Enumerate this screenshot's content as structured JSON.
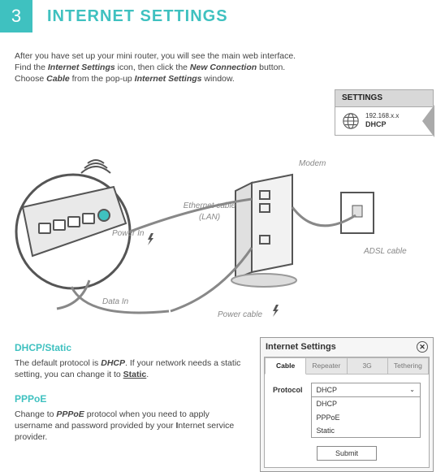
{
  "header": {
    "step": "3",
    "title": "INTERNET SETTINGS"
  },
  "intro": {
    "l1a": "After you have set up your mini router, you will see the main web interface.",
    "l2a": "Find the ",
    "l2b": "Internet Settings",
    "l2c": " icon, then click the ",
    "l2d": "New Connection",
    "l2e": " button.",
    "l3a": "Choose ",
    "l3b": "Cable",
    "l3c": " from the pop-up ",
    "l3d": "Internet Settings",
    "l3e": " window."
  },
  "badge": {
    "title": "SETTINGS",
    "ip": "192.168.x.x",
    "mode": "DHCP"
  },
  "diagram": {
    "modem": "Modem",
    "eth": "Ethernet cable",
    "lan": "(LAN)",
    "powerin": "Power In",
    "adsl": "ADSL cable",
    "datain": "Data In",
    "powercable": "Power cable"
  },
  "dhcp": {
    "h": "DHCP/Static",
    "p1": "The default protocol is ",
    "p2": "DHCP",
    "p3": ". If your network needs a static setting, you can change it to ",
    "p4": "Static",
    "p5": "."
  },
  "pppoe": {
    "h": "PPPoE",
    "p1": "Change to ",
    "p2": "PPPoE",
    "p3": " protocol when you need to apply username and password provided by your ",
    "p4": "I",
    "p5": "nternet service provider."
  },
  "dialog": {
    "title": "Internet Settings",
    "tabs": [
      "Cable",
      "Repeater",
      "3G",
      "Tethering"
    ],
    "protoLabel": "Protocol",
    "selected": "DHCP",
    "options": [
      "DHCP",
      "PPPoE",
      "Static"
    ],
    "submit": "Submit"
  }
}
